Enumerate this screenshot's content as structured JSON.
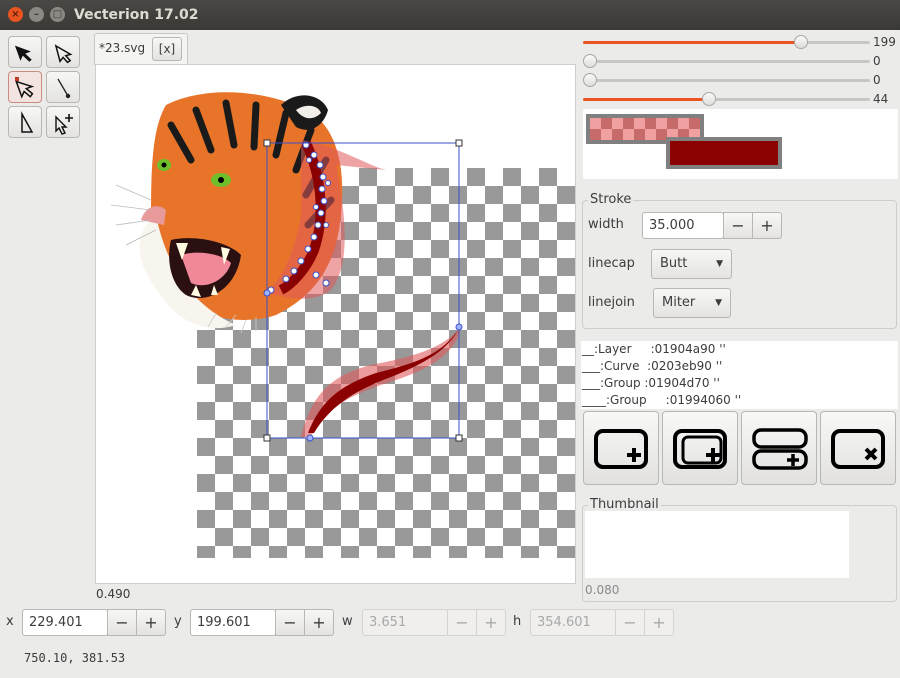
{
  "window": {
    "title": "Vecterion 17.02",
    "close_glyph": "×",
    "min_glyph": "–",
    "max_glyph": "□"
  },
  "toolbox": [
    {
      "name": "select-arrow-icon"
    },
    {
      "name": "node-edit-icon"
    },
    {
      "name": "transform-icon"
    },
    {
      "name": "pen-line-icon"
    },
    {
      "name": "path-select-icon"
    },
    {
      "name": "add-node-icon"
    }
  ],
  "tab": {
    "label": "*23.svg",
    "close_label": "[x]"
  },
  "canvas": {
    "zoom": "0.490"
  },
  "sliders": [
    {
      "value": 199,
      "fraction": 0.76
    },
    {
      "value": 0,
      "fraction": 0.0
    },
    {
      "value": 0,
      "fraction": 0.0
    },
    {
      "value": 44,
      "fraction": 0.44
    }
  ],
  "colors": {
    "fill": "#f0a0a0",
    "stroke": "#8b0000",
    "accent": "#e95420"
  },
  "stroke": {
    "title": "Stroke",
    "width_label": "width",
    "width_value": "35.000",
    "linecap_label": "linecap",
    "linecap_value": "Butt",
    "linejoin_label": "linejoin",
    "linejoin_value": "Miter",
    "minus": "−",
    "plus": "+"
  },
  "tree": [
    "__:Layer     :01904a90 ''",
    "___:Curve  :0203eb90 ''",
    "___:Group :01904d70 ''",
    "____:Group     :01994060 ''"
  ],
  "actions": [
    {
      "name": "add-layer-icon"
    },
    {
      "name": "add-group-icon"
    },
    {
      "name": "add-sublayer-icon"
    },
    {
      "name": "delete-layer-icon"
    }
  ],
  "thumbnail": {
    "title": "Thumbnail",
    "value": "0.080"
  },
  "geometry": {
    "x_label": "x",
    "x_value": "229.401",
    "y_label": "y",
    "y_value": "199.601",
    "w_label": "w",
    "w_value": "3.651",
    "h_label": "h",
    "h_value": "354.601"
  },
  "status": {
    "coords": "750.10, 381.53"
  }
}
